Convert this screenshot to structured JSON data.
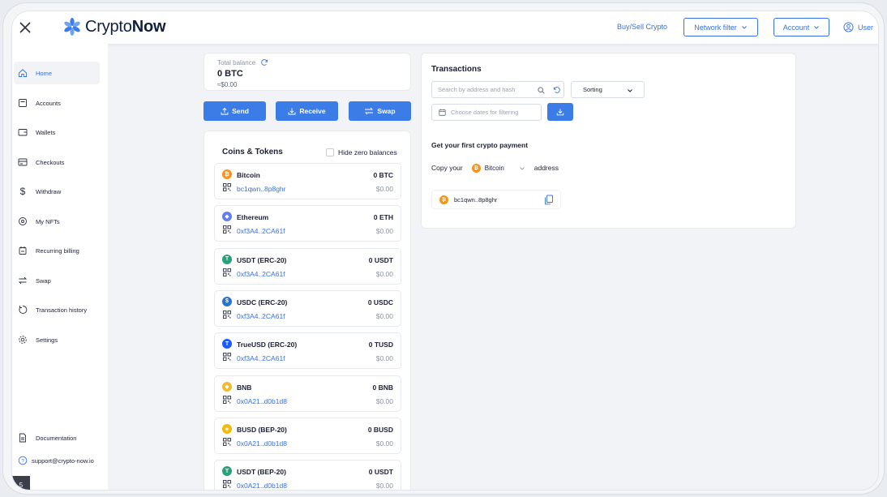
{
  "header": {
    "logo_text_light": "Crypto",
    "logo_text_bold": "Now",
    "buy_sell_label": "Buy/Sell Crypto",
    "network_filter_label": "Network filter",
    "account_label": "Account",
    "user_label": "User"
  },
  "sidebar": {
    "items": [
      {
        "label": "Home",
        "icon": "home-icon"
      },
      {
        "label": "Accounts",
        "icon": "accounts-icon"
      },
      {
        "label": "Wallets",
        "icon": "wallet-icon"
      },
      {
        "label": "Checkouts",
        "icon": "checkout-icon"
      },
      {
        "label": "Withdraw",
        "icon": "dollar-icon"
      },
      {
        "label": "My NFTs",
        "icon": "nft-icon"
      },
      {
        "label": "Recurring billing",
        "icon": "billing-icon"
      },
      {
        "label": "Swap",
        "icon": "swap-icon"
      },
      {
        "label": "Transaction history",
        "icon": "history-icon"
      },
      {
        "label": "Settings",
        "icon": "gear-icon"
      }
    ],
    "documentation_label": "Documentation",
    "support_label": "support@crypto-now.io",
    "badge": "5"
  },
  "balance": {
    "label": "Total balance",
    "btc": "0 BTC",
    "fiat": "≈$0.00"
  },
  "actions": {
    "send": "Send",
    "receive": "Receive",
    "swap": "Swap"
  },
  "coins": {
    "title": "Coins & Tokens",
    "hide_zero_label": "Hide zero balances",
    "items": [
      {
        "name": "Bitcoin",
        "balance": "0 BTC",
        "address": "bc1qwn..8p8ghr",
        "fiat": "$0.00",
        "color": "#f7931a",
        "glyph": "₿"
      },
      {
        "name": "Ethereum",
        "balance": "0 ETH",
        "address": "0xf3A4..2CA61f",
        "fiat": "$0.00",
        "color": "#627eea",
        "glyph": "◆"
      },
      {
        "name": "USDT (ERC-20)",
        "balance": "0 USDT",
        "address": "0xf3A4..2CA61f",
        "fiat": "$0.00",
        "color": "#26a17b",
        "glyph": "T"
      },
      {
        "name": "USDC (ERC-20)",
        "balance": "0 USDC",
        "address": "0xf3A4..2CA61f",
        "fiat": "$0.00",
        "color": "#2775ca",
        "glyph": "$"
      },
      {
        "name": "TrueUSD (ERC-20)",
        "balance": "0 TUSD",
        "address": "0xf3A4..2CA61f",
        "fiat": "$0.00",
        "color": "#1a5aff",
        "glyph": "T"
      },
      {
        "name": "BNB",
        "balance": "0 BNB",
        "address": "0x0A21..d0b1d8",
        "fiat": "$0.00",
        "color": "#f3ba2f",
        "glyph": "◆"
      },
      {
        "name": "BUSD (BEP-20)",
        "balance": "0 BUSD",
        "address": "0x0A21..d0b1d8",
        "fiat": "$0.00",
        "color": "#f0b90b",
        "glyph": "◈"
      },
      {
        "name": "USDT (BEP-20)",
        "balance": "0 USDT",
        "address": "0x0A21..d0b1d8",
        "fiat": "$0.00",
        "color": "#26a17b",
        "glyph": "T"
      }
    ]
  },
  "transactions": {
    "title": "Transactions",
    "search_placeholder": "Search by address and hash",
    "sorting_label": "Sorting",
    "dates_placeholder": "Choose dates for filtering",
    "first_payment_title": "Get your first crypto payment",
    "copy_your_label": "Copy your",
    "coin_select_value": "Bitcoin",
    "address_label": "address",
    "address_value": "bc1qwn..8p8ghr"
  },
  "colors": {
    "accent": "#3b7ce6",
    "link": "#3570e6",
    "bitcoin": "#f7931a"
  }
}
